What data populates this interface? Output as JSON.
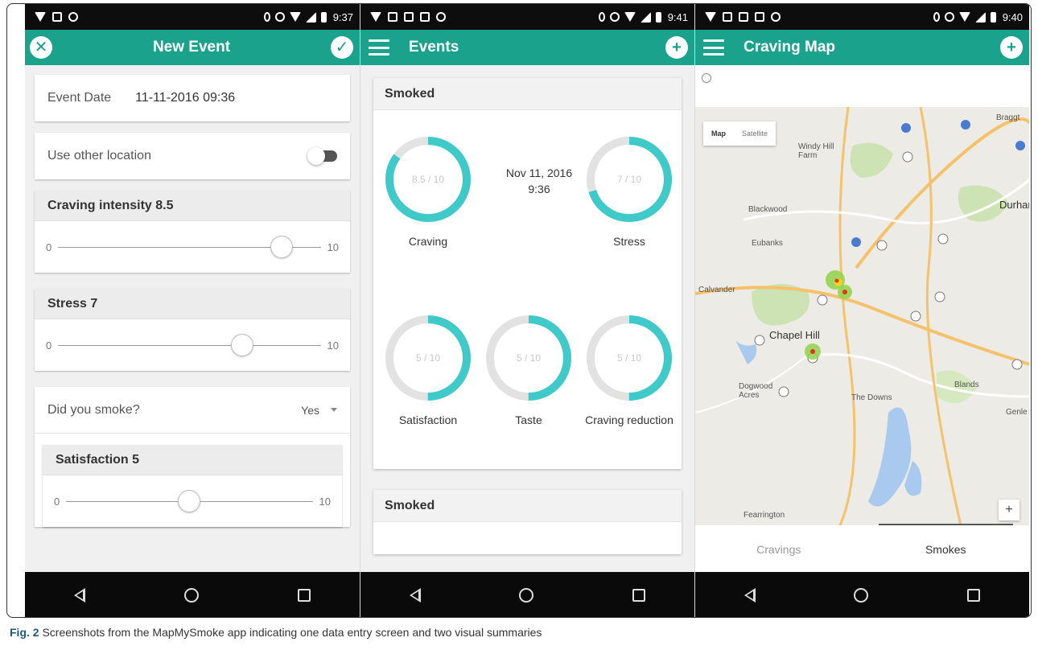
{
  "caption": {
    "fig_label": "Fig. 2",
    "text": "Screenshots from the MapMySmoke app indicating one data entry screen and two visual summaries"
  },
  "screens": [
    {
      "status_time": "9:37",
      "title": "New Event",
      "left_icon": "close-icon",
      "right_icon": "check-icon",
      "event_date_label": "Event Date",
      "event_date_value": "11-11-2016 09:36",
      "other_location_label": "Use other location",
      "other_location_on": false,
      "craving": {
        "label": "Craving intensity 8.5",
        "min": "0",
        "max": "10",
        "value": 8.5
      },
      "stress": {
        "label": "Stress 7",
        "min": "0",
        "max": "10",
        "value": 7
      },
      "smoke_question": "Did you smoke?",
      "smoke_answer": "Yes",
      "satisfaction": {
        "label": "Satisfaction 5",
        "min": "0",
        "max": "10",
        "value": 5
      }
    },
    {
      "status_time": "9:41",
      "title": "Events",
      "left_icon": "menu-icon",
      "right_icon": "add-icon",
      "card_title": "Smoked",
      "card2_title": "Smoked",
      "date_line1": "Nov 11, 2016",
      "date_line2": "9:36",
      "gauges": [
        {
          "label": "Craving",
          "value_text": "8.5 / 10",
          "value": 8.5
        },
        {
          "label": "Stress",
          "value_text": "7 / 10",
          "value": 7
        },
        {
          "label": "Satisfaction",
          "value_text": "5 / 10",
          "value": 5
        },
        {
          "label": "Taste",
          "value_text": "5 / 10",
          "value": 5
        },
        {
          "label": "Craving reduction",
          "value_text": "5 / 10",
          "value": 5
        }
      ]
    },
    {
      "status_time": "9:40",
      "title": "Craving Map",
      "left_icon": "menu-icon",
      "right_icon": "add-icon",
      "map_type": {
        "map": "Map",
        "satellite": "Satellite",
        "selected": "Map"
      },
      "places": [
        "Windy Hill Farm",
        "Blackwood",
        "Eubanks",
        "Calvander",
        "Chapel Hill",
        "Dogwood Acres",
        "The Downs",
        "Blands",
        "Fearrington",
        "Durhar",
        "Braggt",
        "Genle"
      ],
      "zoom_label": "+",
      "tabs": [
        {
          "label": "Cravings",
          "active": false
        },
        {
          "label": "Smokes",
          "active": true
        }
      ]
    }
  ],
  "colors": {
    "app_bar": "#1aa28c",
    "gauge_fill": "#3fc9c9",
    "gauge_track": "#e2e2e2"
  }
}
